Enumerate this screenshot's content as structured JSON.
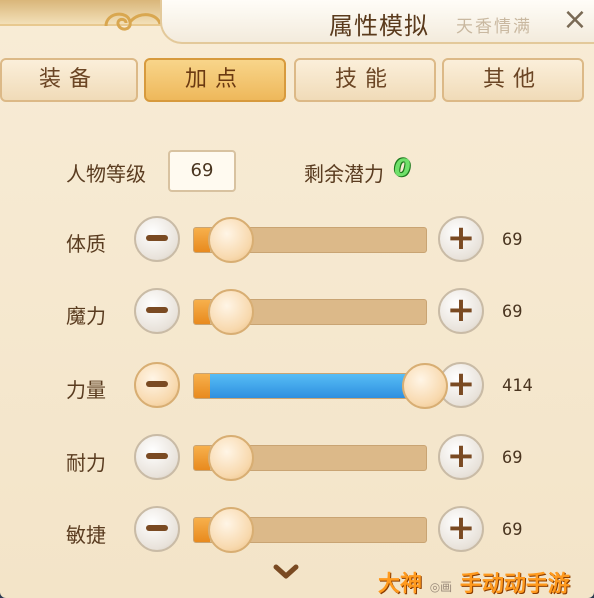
{
  "header": {
    "title": "属性模拟",
    "deco_text": "天香情满",
    "close": "×"
  },
  "tabs": [
    {
      "label": "装备",
      "active": false
    },
    {
      "label": "加点",
      "active": true
    },
    {
      "label": "技能",
      "active": false
    },
    {
      "label": "其他",
      "active": false
    }
  ],
  "level": {
    "label": "人物等级",
    "value": "69"
  },
  "potential": {
    "label": "剩余潜力",
    "value": "0"
  },
  "attributes": [
    {
      "label": "体质",
      "value": "69",
      "fraction": 0.0
    },
    {
      "label": "魔力",
      "value": "69",
      "fraction": 0.0
    },
    {
      "label": "力量",
      "value": "414",
      "fraction": 1.0
    },
    {
      "label": "耐力",
      "value": "69",
      "fraction": 0.0
    },
    {
      "label": "敏捷",
      "value": "69",
      "fraction": 0.0
    }
  ],
  "watermark": {
    "text": "手动动手游",
    "left": "大神",
    "small": "◎画"
  },
  "colors": {
    "accent": "#eeb85b",
    "potential": "#6fe06a",
    "fill_base": "#e88a1e",
    "fill_added": "#2e8fe0"
  }
}
